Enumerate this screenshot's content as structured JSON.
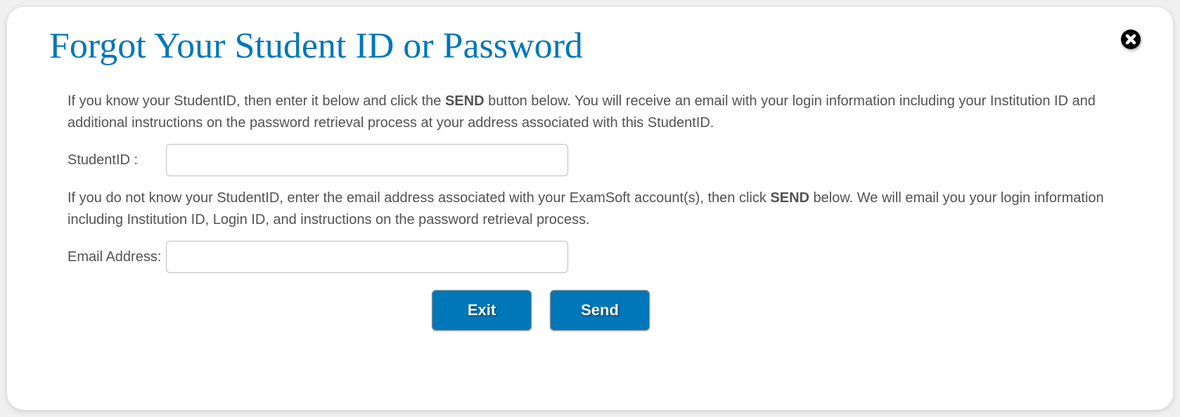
{
  "dialog": {
    "title": "Forgot Your Student ID or Password",
    "desc1_pre": "If you know your StudentID, then enter it below and click the ",
    "desc1_strong": "SEND",
    "desc1_post": " button below. You will receive an email with your login information including your Institution ID and additional instructions on the password retrieval process at your address associated with this StudentID.",
    "desc2_pre": "If you do not know your StudentID, enter the email address associated with your ExamSoft account(s), then click ",
    "desc2_strong": "SEND",
    "desc2_post": " below. We will email you your login information including Institution ID, Login ID, and instructions on the password retrieval process.",
    "labels": {
      "student_id": "StudentID :",
      "email": "Email Address:"
    },
    "values": {
      "student_id": "",
      "email": ""
    },
    "buttons": {
      "exit": "Exit",
      "send": "Send"
    }
  }
}
